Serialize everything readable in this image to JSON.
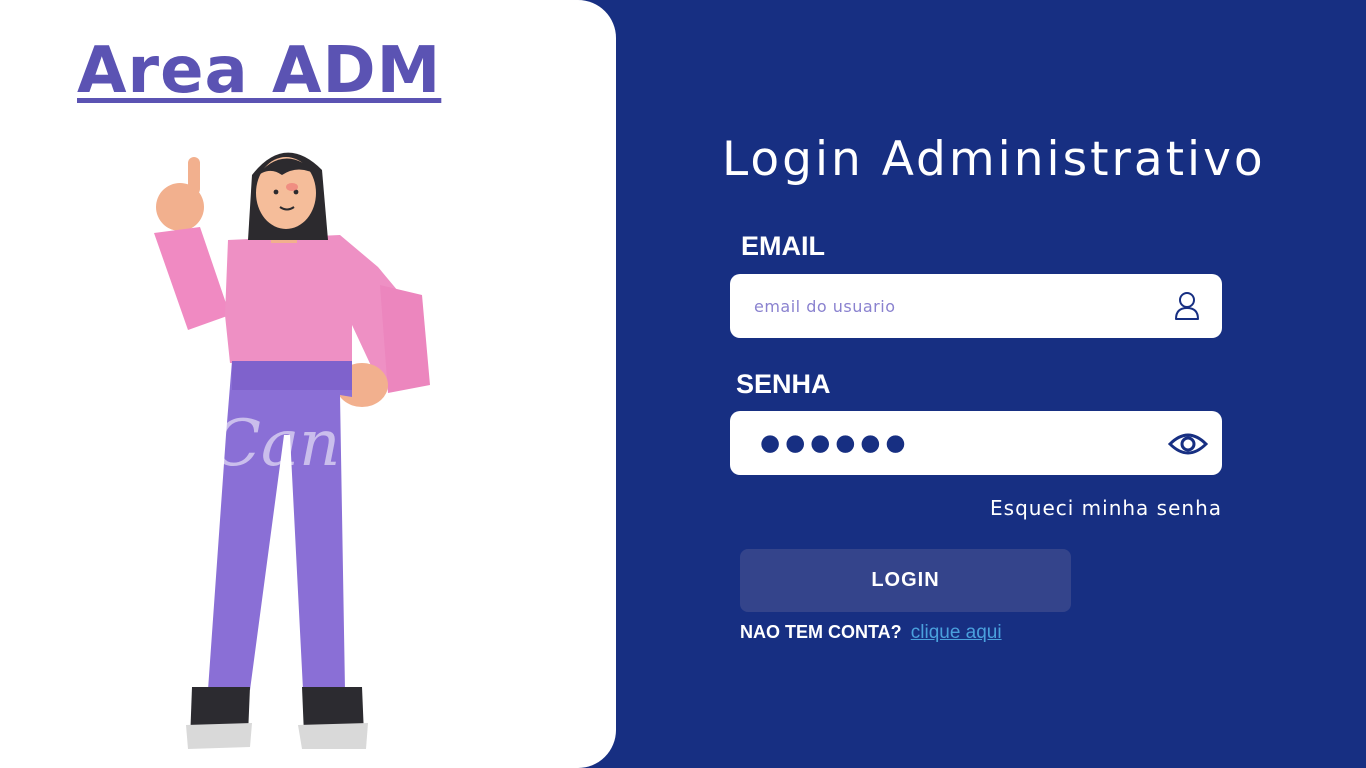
{
  "left": {
    "title": "Area ADM",
    "watermark": "Canva"
  },
  "login": {
    "title": "Login Administrativo",
    "email_label": "EMAIL",
    "email_placeholder": "email do usuario",
    "senha_label": "SENHA",
    "senha_masked": "●●●●●●",
    "forgot_password": "Esqueci minha senha",
    "login_button": "LOGIN",
    "no_account_text": "NAO TEM CONTA?",
    "signup_link": "clique  aqui"
  },
  "icons": {
    "email_field_icon": "user-icon",
    "senha_field_icon": "eye-icon"
  },
  "colors": {
    "background": "#172f82",
    "panel": "#ffffff",
    "title_purple": "#5b53b3",
    "button": "#34448b",
    "link": "#4aa0dd"
  }
}
